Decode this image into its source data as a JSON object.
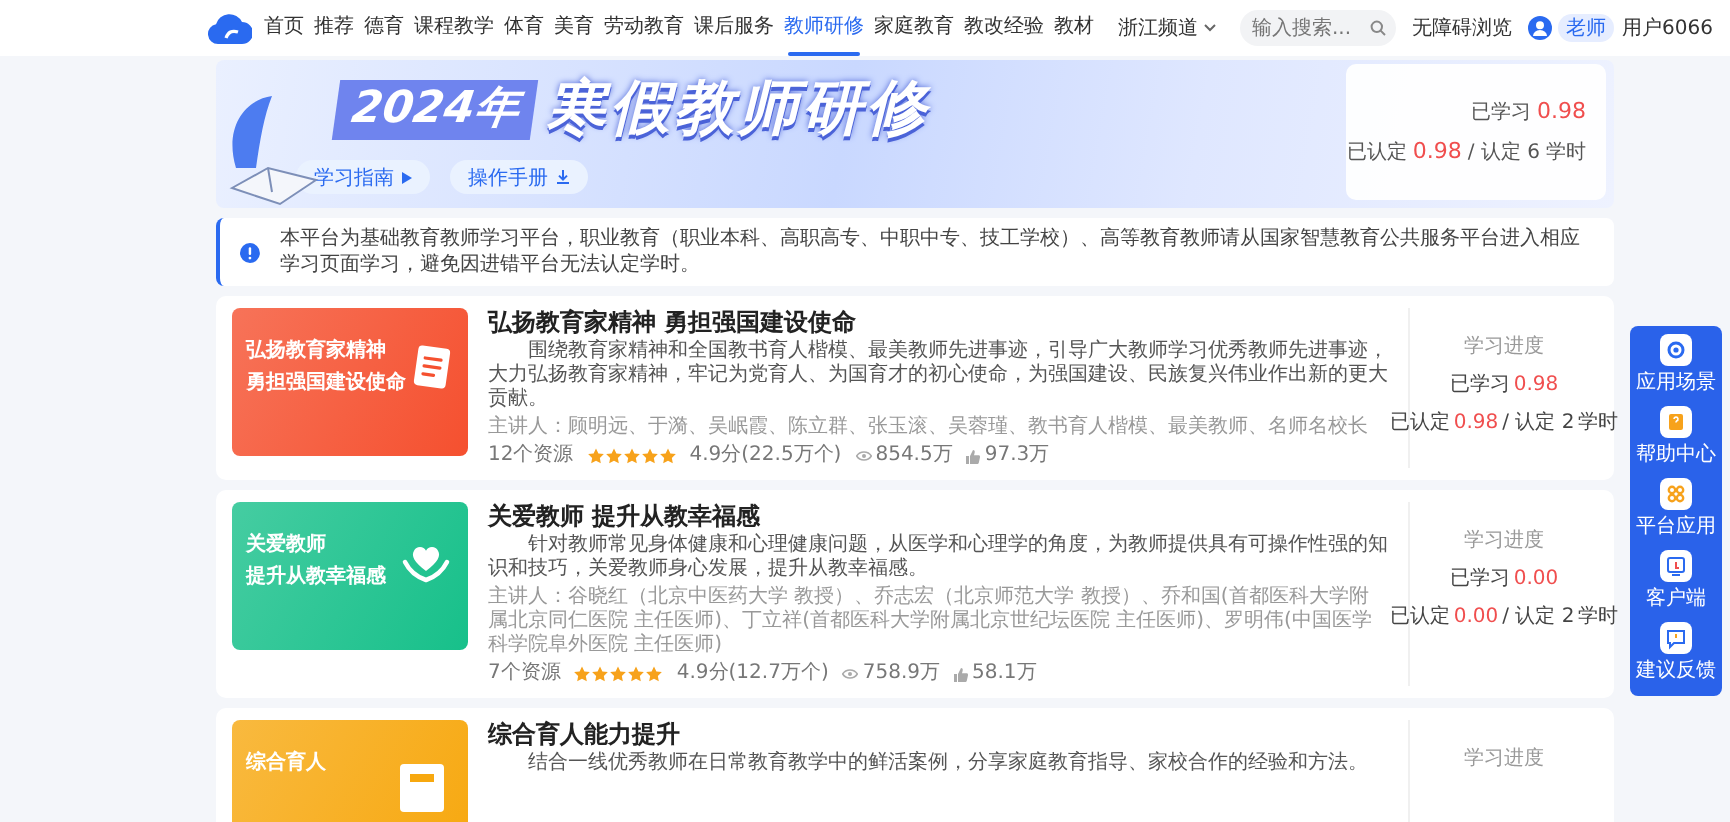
{
  "header": {
    "nav": [
      {
        "label": "首页",
        "selected": false
      },
      {
        "label": "推荐",
        "selected": false
      },
      {
        "label": "德育",
        "selected": false
      },
      {
        "label": "课程教学",
        "selected": false
      },
      {
        "label": "体育",
        "selected": false
      },
      {
        "label": "美育",
        "selected": false
      },
      {
        "label": "劳动教育",
        "selected": false
      },
      {
        "label": "课后服务",
        "selected": false
      },
      {
        "label": "教师研修",
        "selected": true
      },
      {
        "label": "家庭教育",
        "selected": false
      },
      {
        "label": "教改经验",
        "selected": false
      },
      {
        "label": "教材",
        "selected": false
      }
    ],
    "channel": "浙江频道",
    "search": {
      "placeholder": "输入搜索..."
    },
    "accessibility": "无障碍浏览",
    "user": {
      "badge": "老师",
      "name": "用户6066"
    }
  },
  "banner": {
    "year": "2024年",
    "title": "寒假教师研修",
    "buttons": [
      {
        "label": "学习指南",
        "kind": "play"
      },
      {
        "label": "操作手册",
        "kind": "download"
      }
    ],
    "stats": {
      "learned_label": "已学习",
      "learned": "0.98",
      "certified_label": "已认定",
      "certified": "0.98",
      "required": "/ 认定 6",
      "unit": "学时"
    }
  },
  "notice": "本平台为基础教育教师学习平台，职业教育（职业本科、高职高专、中职中专、技工学校）、高等教育教师请从国家智慧教育公共服务平台进入相应学习页面学习，避免因进错平台无法认定学时。",
  "courses": [
    {
      "thumb": {
        "lines": [
          "弘扬教育家精神",
          "勇担强国建设使命"
        ],
        "color": "#f5502f",
        "kind": "document"
      },
      "title": "弘扬教育家精神 勇担强国建设使命",
      "description": "围绕教育家精神和全国教书育人楷模、最美教师先进事迹，引导广大教师学习优秀教师先进事迹，大力弘扬教育家精神，牢记为党育人、为国育才的初心使命，为强国建设、民族复兴伟业作出新的更大贡献。",
      "lecturers": "主讲人：顾明远、于漪、吴岷霞、陈立群、张玉滚、吴蓉瑾、教书育人楷模、最美教师、名师名校长",
      "resources": "12个资源",
      "stars": 5,
      "rating": "4.9分(22.5万个)",
      "views": "854.5万",
      "likes": "97.3万",
      "progress": {
        "label": "学习进度",
        "learned_label": "已学习",
        "learned": "0.98",
        "certified_label": "已认定",
        "certified": "0.98",
        "required": "/ 认定 2",
        "unit": "学时"
      }
    },
    {
      "thumb": {
        "lines": [
          "关爱教师",
          "提升从教幸福感"
        ],
        "color": "#17c08a",
        "kind": "heart"
      },
      "title": "关爱教师 提升从教幸福感",
      "description": "针对教师常见身体健康和心理健康问题，从医学和心理学的角度，为教师提供具有可操作性强的知识和技巧，关爱教师身心发展，提升从教幸福感。",
      "lecturers": "主讲人：谷晓红（北京中医药大学 教授）、乔志宏（北京师范大学 教授）、乔和国(首都医科大学附属北京同仁医院 主任医师)、丁立祥(首都医科大学附属北京世纪坛医院 主任医师)、罗明伟(中国医学科学院阜外医院 主任医师)",
      "resources": "7个资源",
      "stars": 5,
      "rating": "4.9分(12.7万个)",
      "views": "758.9万",
      "likes": "58.1万",
      "progress": {
        "label": "学习进度",
        "learned_label": "已学习",
        "learned": "0.00",
        "certified_label": "已认定",
        "certified": "0.00",
        "required": "/ 认定 2",
        "unit": "学时"
      }
    },
    {
      "thumb": {
        "lines": [
          "综合育人"
        ],
        "color": "#f7a80f",
        "kind": "book"
      },
      "title": "综合育人能力提升",
      "description": "结合一线优秀教师在日常教育教学中的鲜活案例，分享家庭教育指导、家校合作的经验和方法。",
      "progress": {
        "label": "学习进度"
      }
    }
  ],
  "dock": [
    {
      "label": "应用场景",
      "kind": "scene"
    },
    {
      "label": "帮助中心",
      "kind": "help"
    },
    {
      "label": "平台应用",
      "kind": "apps"
    },
    {
      "label": "客户端",
      "kind": "client"
    },
    {
      "label": "建议反馈",
      "kind": "feedback"
    }
  ]
}
